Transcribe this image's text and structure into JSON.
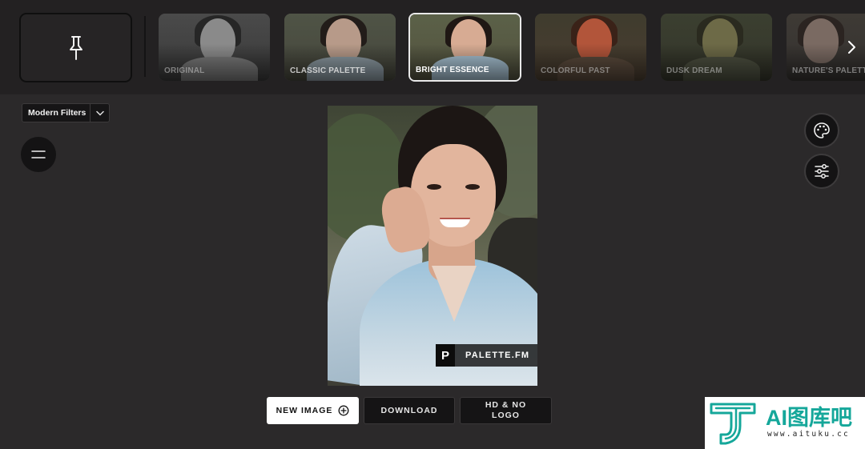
{
  "filter_strip": {
    "filters": [
      {
        "label": "ORIGINAL",
        "style": "original",
        "selected": false
      },
      {
        "label": "CLASSIC PALETTE",
        "style": "classic",
        "selected": false
      },
      {
        "label": "BRIGHT ESSENCE",
        "style": "bright",
        "selected": true
      },
      {
        "label": "COLORFUL PAST",
        "style": "colorful",
        "selected": false
      },
      {
        "label": "DUSK DREAM",
        "style": "dusk",
        "selected": false
      },
      {
        "label": "NATURE'S PALETTE",
        "style": "nature",
        "selected": false
      }
    ],
    "pin_icon": "pin-icon",
    "next_icon": "chevron-right-icon"
  },
  "left_panel": {
    "filter_set_label": "Modern Filters",
    "menu_icon": "menu-icon"
  },
  "right_panel": {
    "palette_icon": "palette-icon",
    "adjust_icon": "sliders-icon"
  },
  "photo": {
    "watermark_letter": "P",
    "watermark_text": "PALETTE.FM"
  },
  "actions": {
    "new_image": "NEW IMAGE",
    "download": "DOWNLOAD",
    "hd_no_logo": "HD & NO LOGO"
  },
  "corner_badge": {
    "title": "AI图库吧",
    "url": "www.aituku.cc"
  },
  "colors": {
    "background": "#2b292a",
    "strip": "#232122",
    "badge_accent": "#15a79a"
  }
}
